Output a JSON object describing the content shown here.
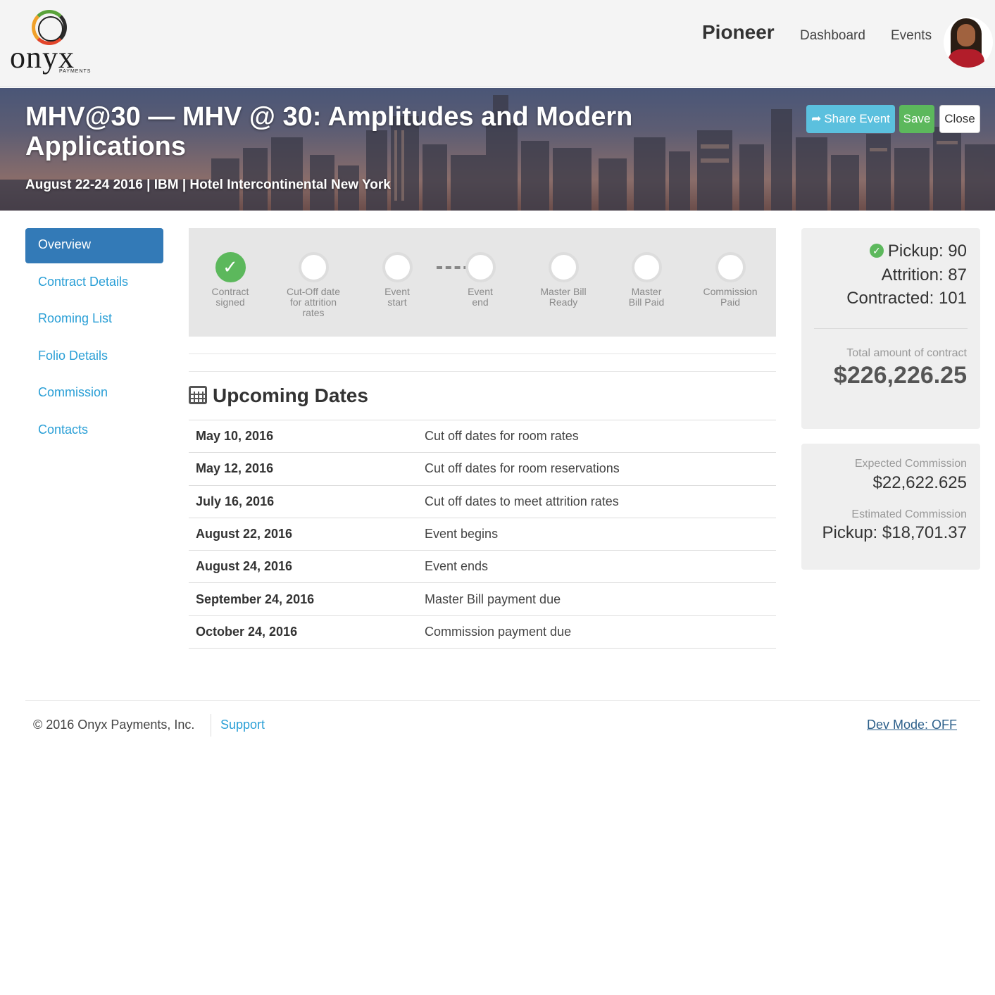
{
  "logo": {
    "word": "onyx",
    "sub": "PAYMENTS"
  },
  "nav": {
    "brand": "Pioneer",
    "links": [
      "Dashboard",
      "Events"
    ]
  },
  "event": {
    "title": "MHV@30 — MHV @ 30: Amplitudes and Modern Applications",
    "subtitle": "August 22-24 2016 | IBM | Hotel Intercontinental New York"
  },
  "actions": {
    "share": "Share Event",
    "save": "Save",
    "close": "Close"
  },
  "sidebar": {
    "items": [
      {
        "label": "Overview",
        "active": true
      },
      {
        "label": "Contract Details"
      },
      {
        "label": "Rooming List"
      },
      {
        "label": "Folio Details"
      },
      {
        "label": "Commission"
      },
      {
        "label": "Contacts"
      }
    ]
  },
  "steps": [
    {
      "l1": "Contract",
      "l2": "signed",
      "l3": "",
      "done": true
    },
    {
      "l1": "Cut-Off date",
      "l2": "for attrition",
      "l3": "rates",
      "done": false
    },
    {
      "l1": "Event",
      "l2": "start",
      "l3": "",
      "done": false
    },
    {
      "l1": "Event",
      "l2": "end",
      "l3": "",
      "done": false
    },
    {
      "l1": "Master Bill",
      "l2": "Ready",
      "l3": "",
      "done": false
    },
    {
      "l1": "Master",
      "l2": "Bill Paid",
      "l3": "",
      "done": false
    },
    {
      "l1": "Commission",
      "l2": "Paid",
      "l3": "",
      "done": false
    }
  ],
  "upcoming": {
    "title": "Upcoming Dates",
    "rows": [
      {
        "date": "May 10, 2016",
        "desc": "Cut off dates for room rates"
      },
      {
        "date": "May 12, 2016",
        "desc": "Cut off dates for room reservations"
      },
      {
        "date": "July 16, 2016",
        "desc": "Cut off dates to meet attrition rates"
      },
      {
        "date": "August 22, 2016",
        "desc": "Event begins"
      },
      {
        "date": "August 24, 2016",
        "desc": "Event ends"
      },
      {
        "date": "September 24, 2016",
        "desc": "Master Bill payment due"
      },
      {
        "date": "October 24, 2016",
        "desc": "Commission payment due"
      }
    ]
  },
  "stats": {
    "pickup": "Pickup: 90",
    "attrition": "Attrition: 87",
    "contracted": "Contracted: 101",
    "total_label": "Total amount of contract",
    "total_value": "$226,226.25"
  },
  "commission": {
    "expected_label": "Expected Commission",
    "expected_value": "$22,622.625",
    "estimated_label": "Estimated Commission",
    "estimated_value": "Pickup: $18,701.37"
  },
  "footer": {
    "copyright": "© 2016 Onyx Payments, Inc.",
    "support": "Support",
    "devmode": "Dev Mode: OFF"
  },
  "colors": {
    "accent": "#337ab7",
    "link": "#2a9fd6",
    "success": "#5cb85c",
    "info": "#5bc0de"
  }
}
